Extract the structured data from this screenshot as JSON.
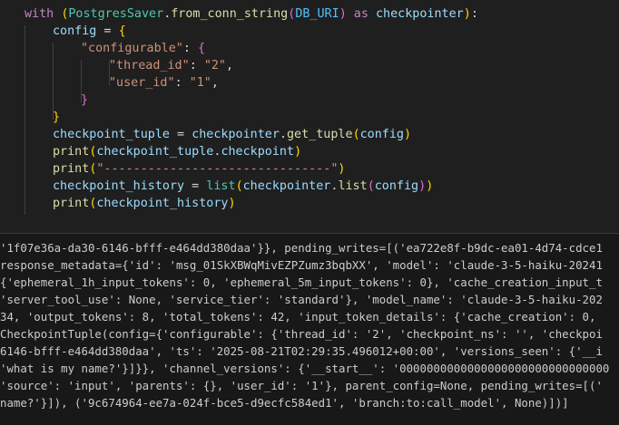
{
  "editor": {
    "lines": [
      {
        "indent": 0,
        "tokens": [
          {
            "t": "with ",
            "c": "kw"
          },
          {
            "t": "(",
            "c": "p1"
          },
          {
            "t": "PostgresSaver",
            "c": "cls"
          },
          {
            "t": ".",
            "c": "txt"
          },
          {
            "t": "from_conn_string",
            "c": "fn"
          },
          {
            "t": "(",
            "c": "p2"
          },
          {
            "t": "DB_URI",
            "c": "const"
          },
          {
            "t": ")",
            "c": "p2"
          },
          {
            "t": " as ",
            "c": "kw"
          },
          {
            "t": "checkpointer",
            "c": "var"
          },
          {
            "t": ")",
            "c": "p1"
          },
          {
            "t": ":",
            "c": "txt"
          }
        ]
      },
      {
        "indent": 1,
        "tokens": [
          {
            "t": "config",
            "c": "var"
          },
          {
            "t": " = ",
            "c": "txt"
          },
          {
            "t": "{",
            "c": "p1"
          }
        ]
      },
      {
        "indent": 2,
        "tokens": [
          {
            "t": "\"configurable\"",
            "c": "str"
          },
          {
            "t": ": ",
            "c": "txt"
          },
          {
            "t": "{",
            "c": "p2"
          }
        ]
      },
      {
        "indent": 3,
        "tokens": [
          {
            "t": "\"thread_id\"",
            "c": "str"
          },
          {
            "t": ": ",
            "c": "txt"
          },
          {
            "t": "\"2\"",
            "c": "str"
          },
          {
            "t": ",",
            "c": "txt"
          }
        ]
      },
      {
        "indent": 3,
        "tokens": [
          {
            "t": "\"user_id\"",
            "c": "str"
          },
          {
            "t": ": ",
            "c": "txt"
          },
          {
            "t": "\"1\"",
            "c": "str"
          },
          {
            "t": ",",
            "c": "txt"
          }
        ]
      },
      {
        "indent": 2,
        "tokens": [
          {
            "t": "}",
            "c": "p2"
          }
        ]
      },
      {
        "indent": 1,
        "tokens": [
          {
            "t": "}",
            "c": "p1"
          }
        ]
      },
      {
        "indent": 1,
        "tokens": [
          {
            "t": "checkpoint_tuple",
            "c": "var"
          },
          {
            "t": " = ",
            "c": "txt"
          },
          {
            "t": "checkpointer",
            "c": "var"
          },
          {
            "t": ".",
            "c": "txt"
          },
          {
            "t": "get_tuple",
            "c": "fn"
          },
          {
            "t": "(",
            "c": "p1"
          },
          {
            "t": "config",
            "c": "var"
          },
          {
            "t": ")",
            "c": "p1"
          }
        ]
      },
      {
        "indent": 1,
        "tokens": [
          {
            "t": "print",
            "c": "fn"
          },
          {
            "t": "(",
            "c": "p1"
          },
          {
            "t": "checkpoint_tuple",
            "c": "var"
          },
          {
            "t": ".",
            "c": "txt"
          },
          {
            "t": "checkpoint",
            "c": "var"
          },
          {
            "t": ")",
            "c": "p1"
          }
        ]
      },
      {
        "indent": 1,
        "tokens": [
          {
            "t": "print",
            "c": "fn"
          },
          {
            "t": "(",
            "c": "p1"
          },
          {
            "t": "\"-------------------------------\"",
            "c": "str"
          },
          {
            "t": ")",
            "c": "p1"
          }
        ]
      },
      {
        "indent": 1,
        "tokens": [
          {
            "t": "checkpoint_history",
            "c": "var"
          },
          {
            "t": " = ",
            "c": "txt"
          },
          {
            "t": "list",
            "c": "cls"
          },
          {
            "t": "(",
            "c": "p1"
          },
          {
            "t": "checkpointer",
            "c": "var"
          },
          {
            "t": ".",
            "c": "txt"
          },
          {
            "t": "list",
            "c": "fn"
          },
          {
            "t": "(",
            "c": "p2"
          },
          {
            "t": "config",
            "c": "var"
          },
          {
            "t": ")",
            "c": "p2"
          },
          {
            "t": ")",
            "c": "p1"
          }
        ]
      },
      {
        "indent": 1,
        "tokens": [
          {
            "t": "print",
            "c": "fn"
          },
          {
            "t": "(",
            "c": "p1"
          },
          {
            "t": "checkpoint_history",
            "c": "var"
          },
          {
            "t": ")",
            "c": "p1"
          }
        ]
      }
    ]
  },
  "terminal": {
    "lines": [
      "'1f07e36a-da30-6146-bfff-e464dd380daa'}}, pending_writes=[('ea722e8f-b9dc-ea01-4d74-cdce1",
      "response_metadata={'id': 'msg_01SkXBWqMivEZPZumz3bqbXX', 'model': 'claude-3-5-haiku-20241",
      "{'ephemeral_1h_input_tokens': 0, 'ephemeral_5m_input_tokens': 0}, 'cache_creation_input_t",
      "'server_tool_use': None, 'service_tier': 'standard'}, 'model_name': 'claude-3-5-haiku-202",
      "34, 'output_tokens': 8, 'total_tokens': 42, 'input_token_details': {'cache_creation': 0, ",
      "CheckpointTuple(config={'configurable': {'thread_id': '2', 'checkpoint_ns': '', 'checkpoi",
      "6146-bfff-e464dd380daa', 'ts': '2025-08-21T02:29:35.496012+00:00', 'versions_seen': {'__i",
      "'what is my name?'}]}}, 'channel_versions': {'__start__': '0000000000000000000000000000000",
      "'source': 'input', 'parents': {}, 'user_id': '1'}, parent_config=None, pending_writes=[('",
      "name?'}]), ('9c674964-ee7a-024f-bce5-d9ecfc584ed1', 'branch:to:call_model', None)])]"
    ]
  }
}
